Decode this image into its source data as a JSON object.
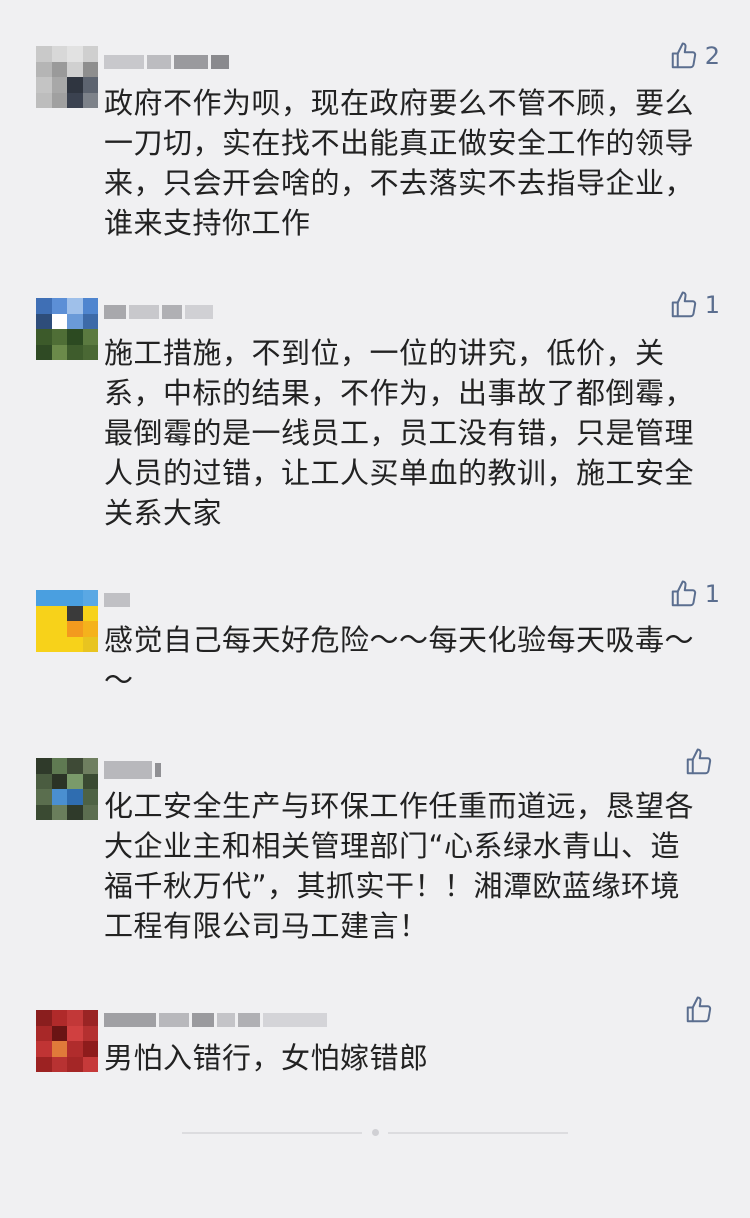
{
  "comments": [
    {
      "likes": "2",
      "text": "政府不作为呗，现在政府要么不管不顾，要么\n一刀切，实在找不出能真正做安全工作的领导\n来，只会开会啥的，不去落实不去指导企业，\n谁来支持你工作"
    },
    {
      "likes": "1",
      "text": "施工措施，不到位，一位的讲究，低价，关\n系，中标的结果，不作为，出事故了都倒霉，\n最倒霉的是一线员工，员工没有错，只是管理\n人员的过错，让工人买单血的教训，施工安全\n关系大家"
    },
    {
      "likes": "1",
      "text": "感觉自己每天好危险～～每天化验每天吸毒～\n～"
    },
    {
      "likes": "",
      "text": "化工安全生产与环保工作任重而道远，恳望各\n大企业主和相关管理部门“心系绿水青山、造\n福千秋万代”，其抓实干！！湘潭欧蓝缘环境\n工程有限公司马工建言！"
    },
    {
      "likes": "",
      "text": "男怕入错行，女怕嫁错郎"
    }
  ],
  "icons": {
    "like": "thumbs-up-icon"
  },
  "colors": {
    "background": "#f0f0f2",
    "text": "#222222",
    "like": "#5b6e8f"
  }
}
